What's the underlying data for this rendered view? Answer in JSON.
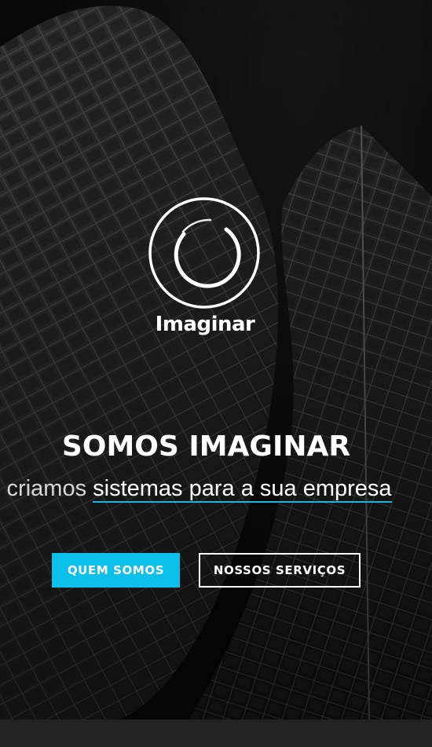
{
  "brand": {
    "name": "Imaginar",
    "logo_icon": "circular-arc-logo-icon"
  },
  "hero": {
    "title": "SOMOS IMAGINAR",
    "tagline_prefix": "s criamos ",
    "tagline_typed": "sistemas para a sua empresa",
    "accent_color": "#0cc0ea"
  },
  "buttons": {
    "primary_label": "QUEM SOMOS",
    "secondary_label": "NOSSOS SERVIÇOS"
  }
}
